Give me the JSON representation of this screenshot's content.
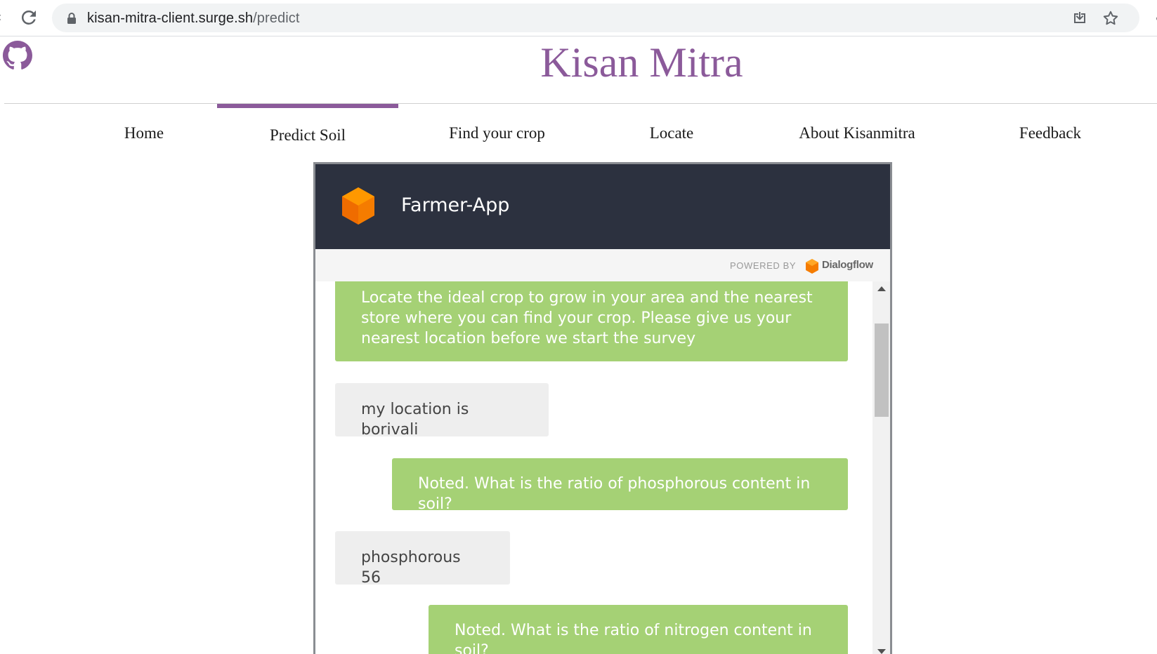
{
  "browser": {
    "url_host": "kisan-mitra-client.surge.sh",
    "url_path": "/predict"
  },
  "site": {
    "title": "Kisan Mitra",
    "accent_color": "#8b5a9a"
  },
  "nav": {
    "items": [
      {
        "label": "Home",
        "active": false
      },
      {
        "label": "Predict Soil",
        "active": true
      },
      {
        "label": "Find your crop",
        "active": false
      },
      {
        "label": "Locate",
        "active": false
      },
      {
        "label": "About Kisanmitra",
        "active": false
      },
      {
        "label": "Feedback",
        "active": false
      }
    ]
  },
  "chat": {
    "agent_name": "Farmer-App",
    "powered_by": "POWERED BY",
    "provider": "Dialogflow",
    "bot_bubble_color": "#a5d175",
    "user_bubble_color": "#eeeeee",
    "messages": [
      {
        "from": "bot",
        "text": "Locate the ideal crop to grow in your area and the nearest store where you can find your crop. Please give us your nearest location before we start the survey"
      },
      {
        "from": "user",
        "text": "my location is borivali"
      },
      {
        "from": "bot",
        "text": "Noted. What is the ratio of phosphorous content in soil?"
      },
      {
        "from": "user",
        "text": "phosphorous 56"
      },
      {
        "from": "bot",
        "text": "Noted. What is the ratio of nitrogen content in soil?"
      }
    ]
  },
  "icons": [
    "reload-icon",
    "lock-icon",
    "install-icon",
    "star-icon",
    "github-icon",
    "dialogflow-logo-icon"
  ]
}
